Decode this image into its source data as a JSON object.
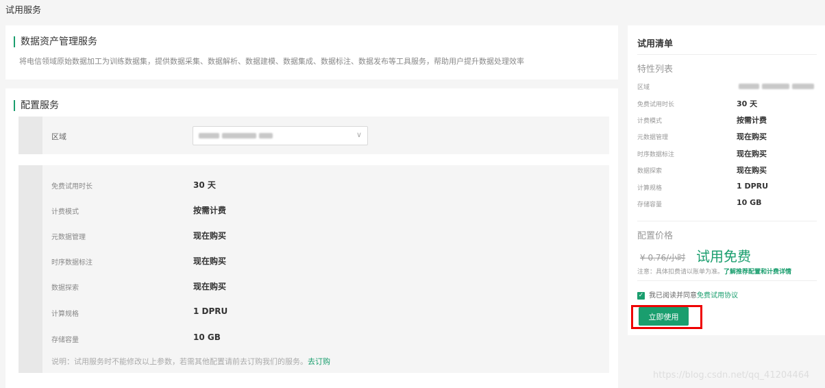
{
  "page_title": "试用服务",
  "intro": {
    "title": "数据资产管理服务",
    "description": "将电信领域原始数据加工为训练数据集，提供数据采集、数据解析、数据建模、数据集成、数据标注、数据发布等工具服务，帮助用户提升数据处理效率"
  },
  "config": {
    "title": "配置服务",
    "region_label": "区域",
    "params": [
      {
        "label": "免费试用时长",
        "value": "30 天"
      },
      {
        "label": "计费模式",
        "value": "按需计费"
      },
      {
        "label": "元数据管理",
        "value": "现在购买"
      },
      {
        "label": "时序数据标注",
        "value": "现在购买"
      },
      {
        "label": "数据探索",
        "value": "现在购买"
      },
      {
        "label": "计算规格",
        "value": "1 DPRU"
      },
      {
        "label": "存储容量",
        "value": "10 GB"
      }
    ],
    "note_text": "说明：试用服务时不能修改以上参数，若需其他配置请前去订购我们的服务。",
    "note_link": "去订购"
  },
  "sidebar": {
    "title": "试用清单",
    "features_title": "特性列表",
    "features": [
      {
        "label": "区域",
        "value": ""
      },
      {
        "label": "免费试用时长",
        "value": "30 天"
      },
      {
        "label": "计费模式",
        "value": "按需计费"
      },
      {
        "label": "元数据管理",
        "value": "现在购买"
      },
      {
        "label": "时序数据标注",
        "value": "现在购买"
      },
      {
        "label": "数据探索",
        "value": "现在购买"
      },
      {
        "label": "计算规格",
        "value": "1 DPRU"
      },
      {
        "label": "存储容量",
        "value": "10 GB"
      }
    ],
    "price_title": "配置价格",
    "price_old": "¥ 0.76/小时",
    "price_free": "试用免费",
    "price_note": "注意：具体扣费请以账单为准。",
    "price_note_link": "了解推荐配置和计费详情",
    "agree_text": "我已阅读并同意",
    "agree_link": "免费试用协议",
    "use_button": "立即使用"
  },
  "watermark": "https://blog.csdn.net/qq_41204464",
  "colors": {
    "accent": "#1a9e6e",
    "highlight": "#e00000"
  }
}
